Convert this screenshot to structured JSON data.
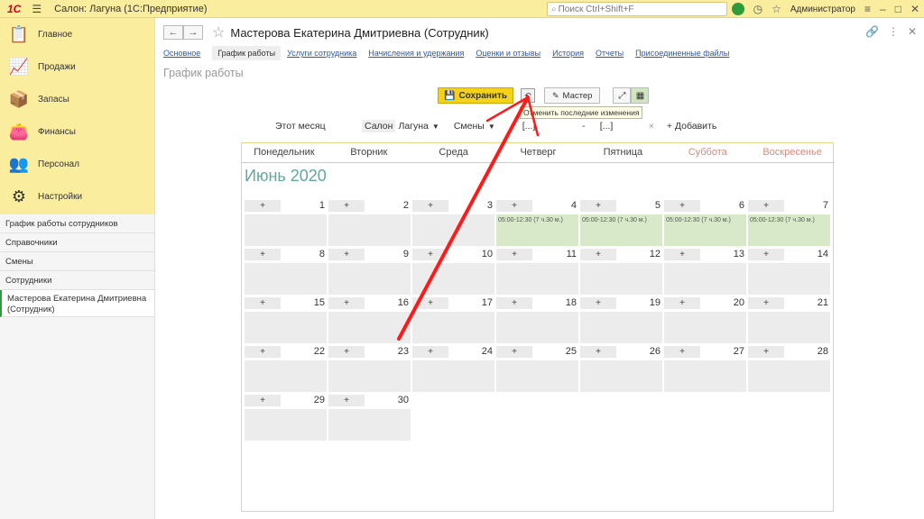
{
  "titlebar": {
    "logo": "1С",
    "title": "Салон: Лагуна  (1С:Предприятие)",
    "search_placeholder": "Поиск Ctrl+Shift+F",
    "user": "Администратор"
  },
  "sidebar": {
    "sections": [
      {
        "label": "Главное",
        "icon": "home-icon"
      },
      {
        "label": "Продажи",
        "icon": "sales-chart-icon"
      },
      {
        "label": "Запасы",
        "icon": "stock-icon"
      },
      {
        "label": "Финансы",
        "icon": "wallet-icon"
      },
      {
        "label": "Персонал",
        "icon": "people-icon"
      },
      {
        "label": "Настройки",
        "icon": "gear-icon"
      }
    ],
    "items": [
      {
        "label": "График работы сотрудников"
      },
      {
        "label": "Справочники"
      },
      {
        "label": "Смены"
      },
      {
        "label": "Сотрудники"
      },
      {
        "label": "Мастерова Екатерина Дмитриевна (Сотрудник)"
      }
    ]
  },
  "header": {
    "title": "Мастерова Екатерина Дмитриевна (Сотрудник)"
  },
  "tabs": [
    {
      "label": "Основное"
    },
    {
      "label": "График работы"
    },
    {
      "label": "Услуги сотрудника"
    },
    {
      "label": "Начисления и удержания"
    },
    {
      "label": "Оценки и отзывы"
    },
    {
      "label": "История"
    },
    {
      "label": "Отчеты"
    },
    {
      "label": "Присоединенные файлы"
    }
  ],
  "subtitle": "График работы",
  "toolbar": {
    "save_label": "Сохранить",
    "master_label": "Мастер",
    "tooltip": "Отменить последние изменения"
  },
  "filters": {
    "month": "Этот месяц",
    "salon_label": "Салон",
    "salon_value": "Лагуна",
    "shifts": "Смены",
    "range_from": "[...]",
    "dash": "-",
    "range_to": "[...]",
    "clear": "×",
    "add": "+ Добавить"
  },
  "calendar": {
    "weekdays": [
      "Понедельник",
      "Вторник",
      "Среда",
      "Четверг",
      "Пятница",
      "Суббота",
      "Воскресенье"
    ],
    "month_title": "Июнь 2020",
    "plus": "+",
    "shift_text": "05:00-12:30 (7 ч.30 м.)",
    "days": [
      "1",
      "2",
      "3",
      "4",
      "5",
      "6",
      "7",
      "8",
      "9",
      "10",
      "11",
      "12",
      "13",
      "14",
      "15",
      "16",
      "17",
      "18",
      "19",
      "20",
      "21",
      "22",
      "23",
      "24",
      "25",
      "26",
      "27",
      "28",
      "29",
      "30"
    ]
  },
  "colors": {
    "accent_yellow": "#fbed9e",
    "save_yellow": "#f5d217",
    "shift_green": "#d7e9c9",
    "arrow_red": "#ff1a1a"
  }
}
